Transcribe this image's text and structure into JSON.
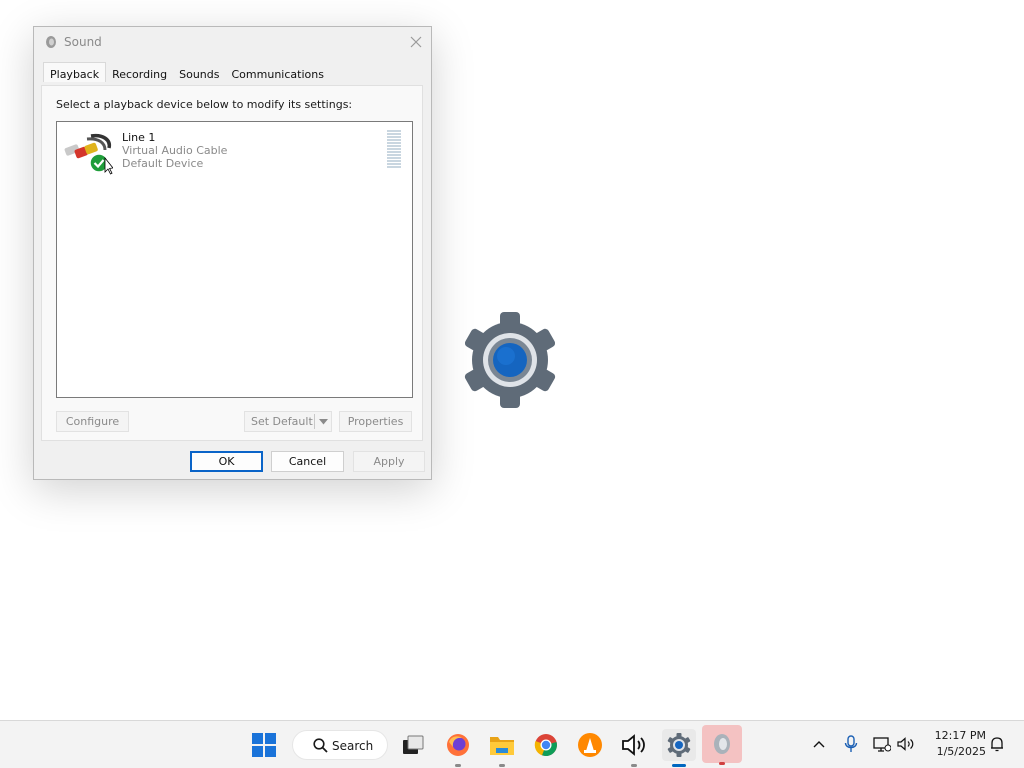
{
  "dialog": {
    "title": "Sound",
    "tabs": [
      {
        "label": "Playback"
      },
      {
        "label": "Recording"
      },
      {
        "label": "Sounds"
      },
      {
        "label": "Communications"
      }
    ],
    "instruction": "Select a playback device below to modify its settings:",
    "device": {
      "name": "Line 1",
      "description": "Virtual Audio Cable",
      "status": "Default Device"
    },
    "buttons": {
      "configure": "Configure",
      "set_default": "Set Default",
      "properties": "Properties",
      "ok": "OK",
      "cancel": "Cancel",
      "apply": "Apply"
    }
  },
  "taskbar": {
    "search_label": "Search",
    "clock": {
      "time": "12:17 PM",
      "date": "1/5/2025"
    },
    "accent": "#0067c0"
  }
}
